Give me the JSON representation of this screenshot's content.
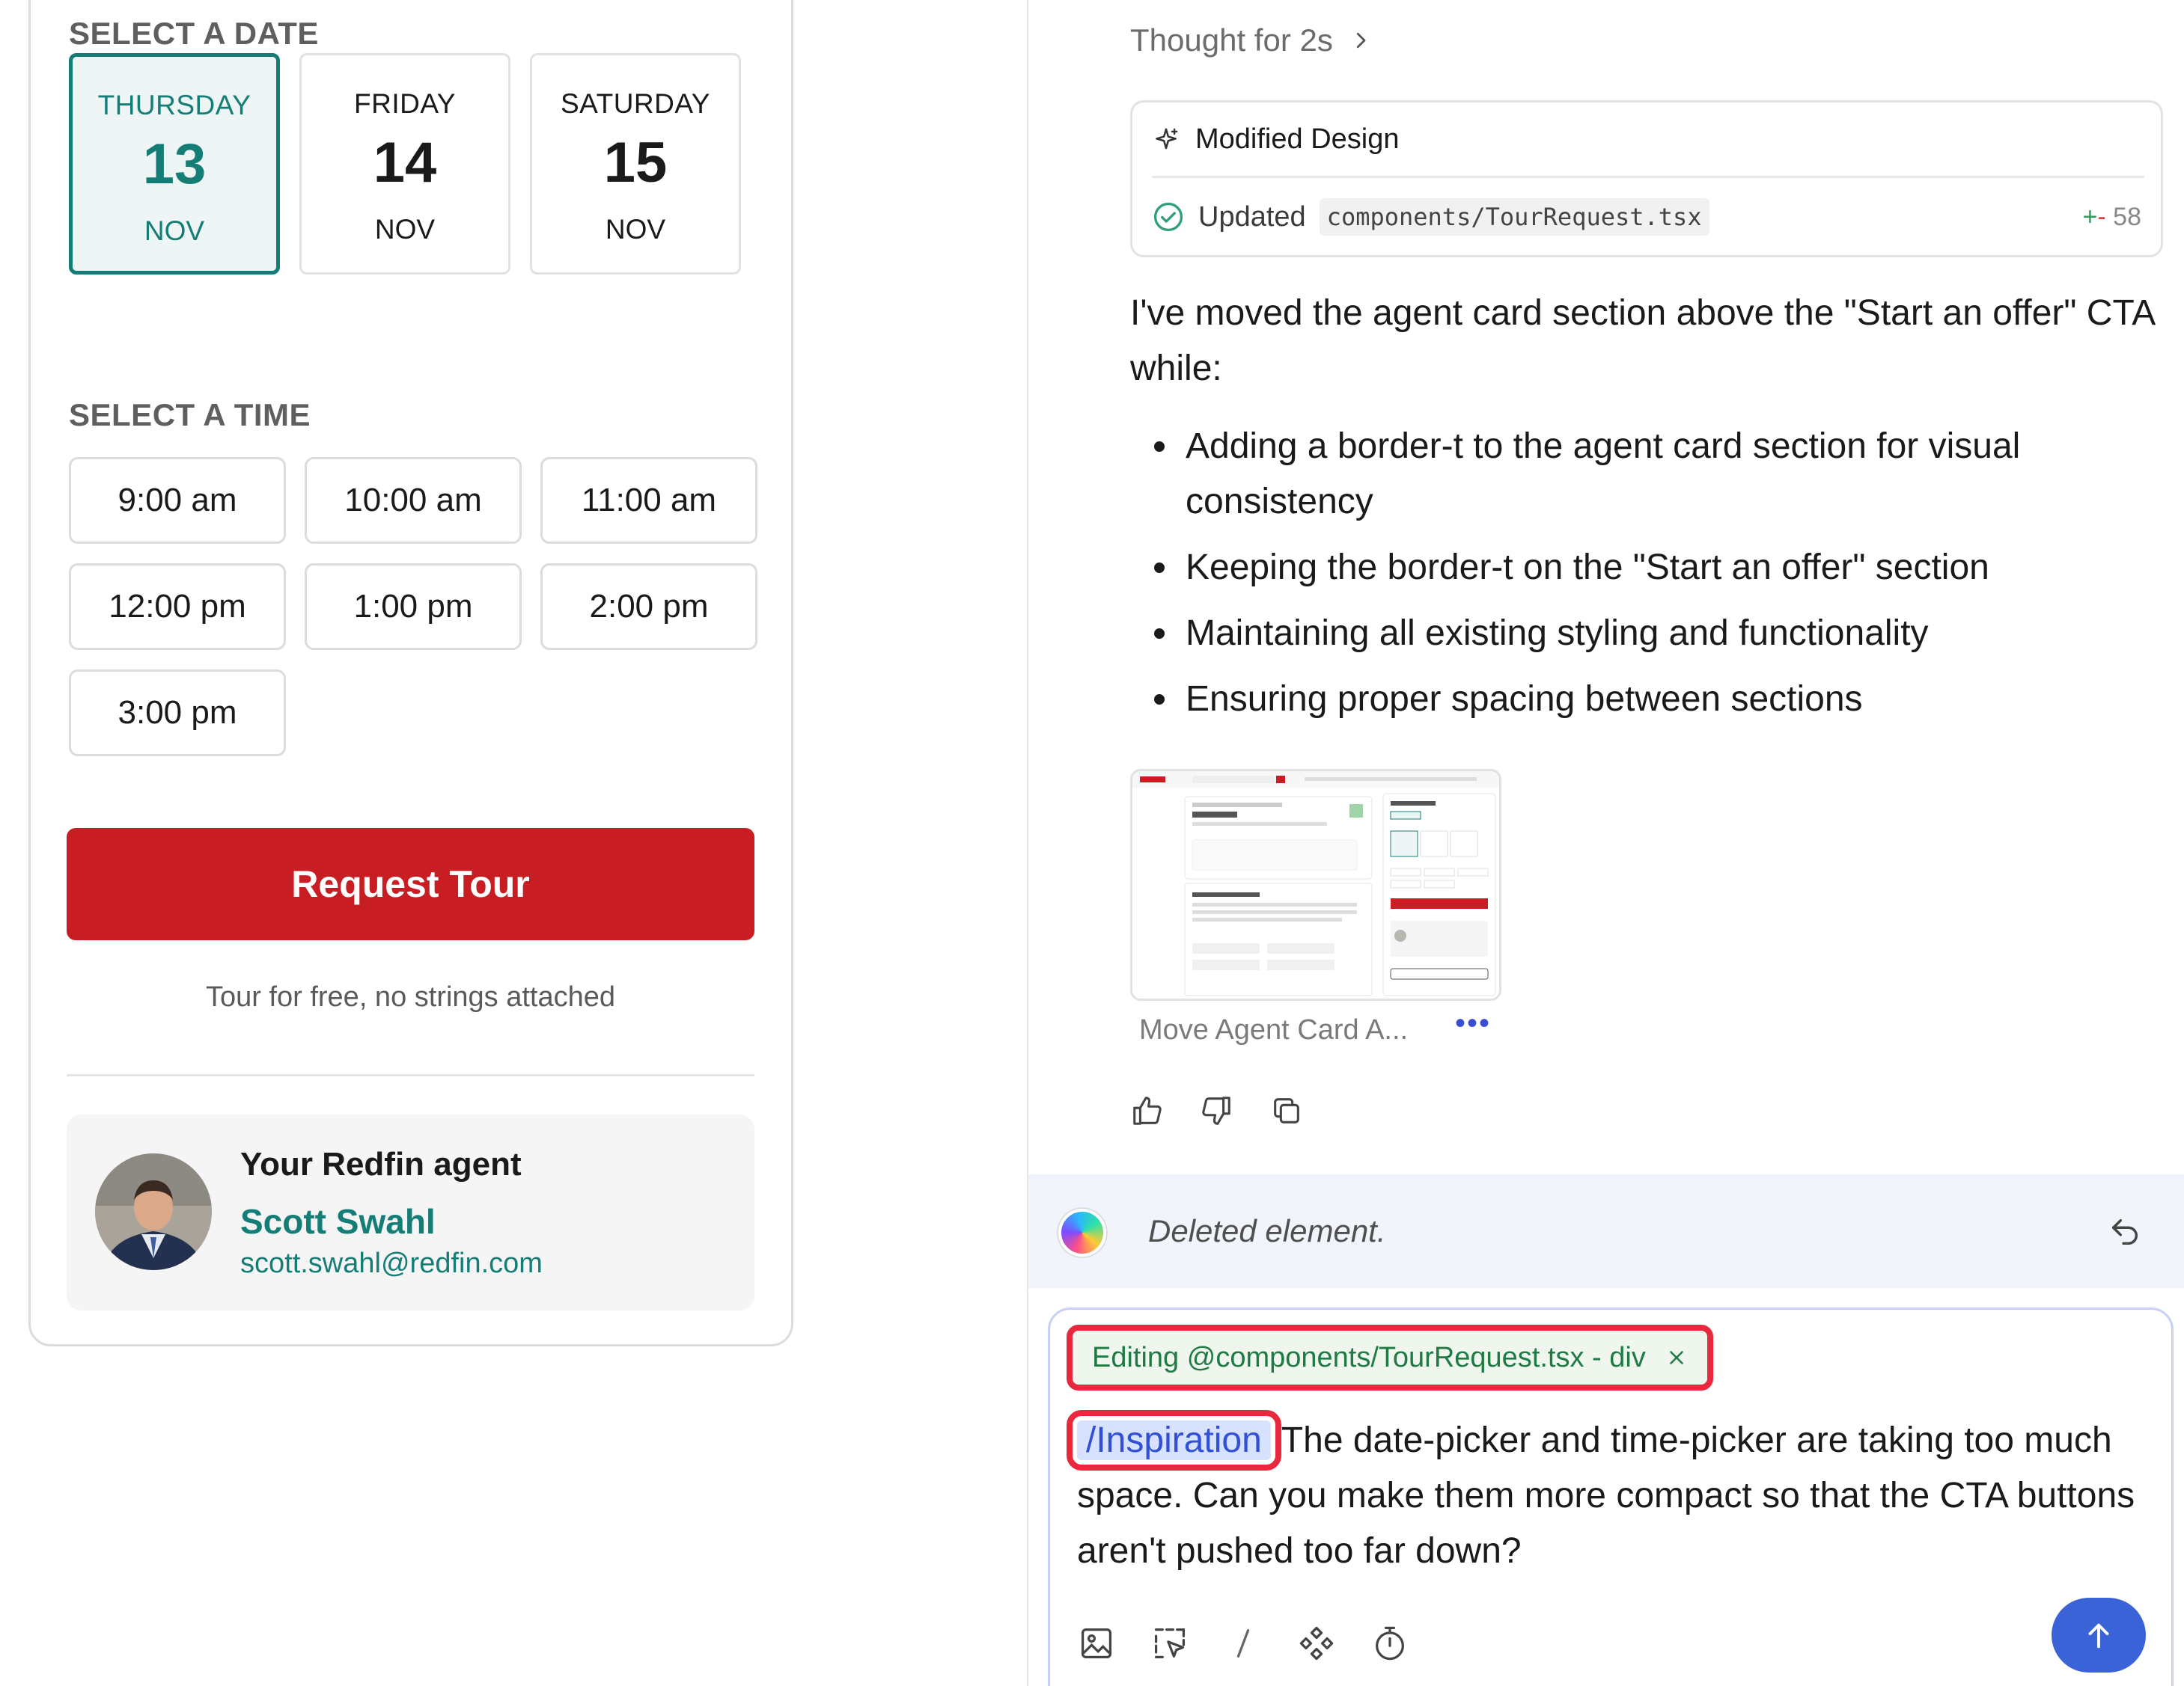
{
  "left": {
    "date_label": "SELECT A DATE",
    "dates": [
      {
        "dow": "THURSDAY",
        "day": "13",
        "mon": "NOV",
        "selected": true
      },
      {
        "dow": "FRIDAY",
        "day": "14",
        "mon": "NOV",
        "selected": false
      },
      {
        "dow": "SATURDAY",
        "day": "15",
        "mon": "NOV",
        "selected": false
      }
    ],
    "time_label": "SELECT A TIME",
    "times": [
      "9:00 am",
      "10:00 am",
      "11:00 am",
      "12:00 pm",
      "1:00 pm",
      "2:00 pm",
      "3:00 pm"
    ],
    "request_label": "Request Tour",
    "tour_note": "Tour for free, no strings attached",
    "agent": {
      "heading": "Your Redfin agent",
      "name": "Scott Swahl",
      "email": "scott.swahl@redfin.com"
    }
  },
  "right": {
    "thought": "Thought for 2s",
    "modified_card": {
      "title": "Modified Design",
      "status": "Updated",
      "file": "components/TourRequest.tsx",
      "diff_plus": "+",
      "diff_minus": "-",
      "diff_count": "58"
    },
    "message_intro": "I've moved the agent card section above the \"Start an offer\" CTA while:",
    "bullets": [
      "Adding a border-t to the agent card section for visual consistency",
      "Keeping the border-t on the \"Start an offer\" section",
      "Maintaining all existing styling and functionality",
      "Ensuring proper spacing between sections"
    ],
    "thumbnail_caption": "Move Agent Card A...",
    "thumbnail_more": "•••",
    "system_message": "Deleted element.",
    "composer": {
      "context_chip": "Editing @components/TourRequest.tsx - div",
      "slash_command": "/Inspiration",
      "text": "The date-picker and time-picker are taking too much space. Can you make them more compact so that the CTA buttons aren't pushed too far down?"
    }
  },
  "colors": {
    "teal": "#147d75",
    "red": "#c81e23",
    "highlight_red": "#e8283d",
    "send_blue": "#3a63d8"
  },
  "icons": [
    "chevron-right-icon",
    "sparkle-icon",
    "check-circle-icon",
    "thumbs-up-icon",
    "thumbs-down-icon",
    "copy-icon",
    "undo-icon",
    "close-icon",
    "image-icon",
    "select-element-icon",
    "slash-icon",
    "component-icon",
    "timer-icon",
    "arrow-up-icon"
  ]
}
